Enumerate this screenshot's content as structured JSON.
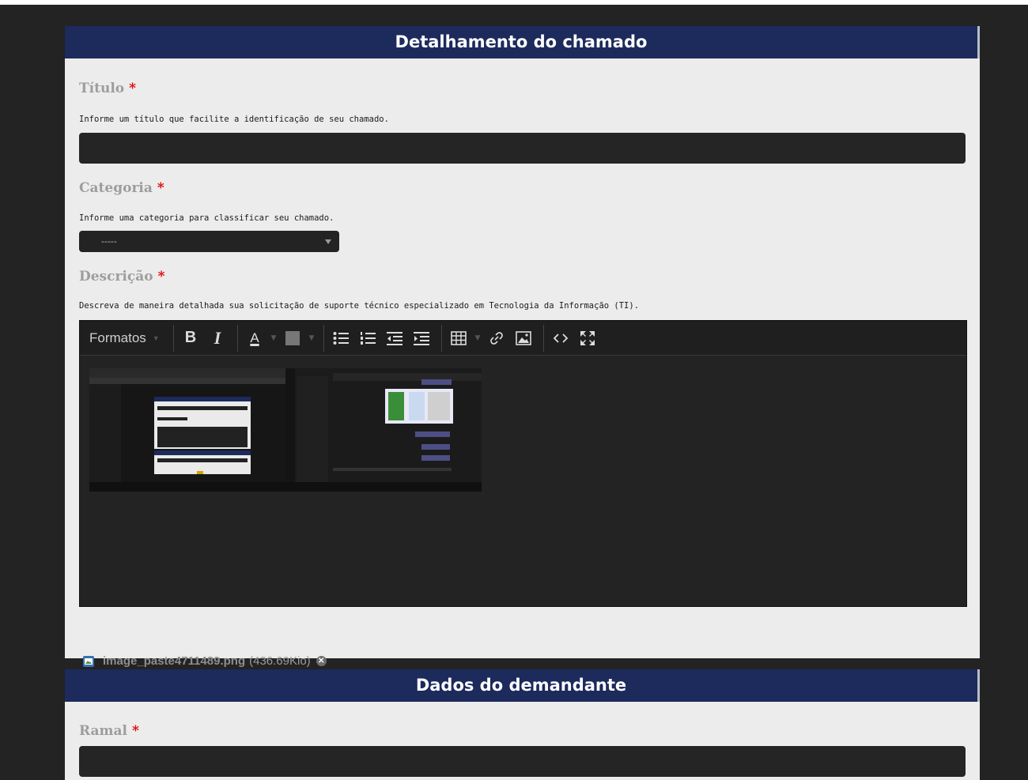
{
  "section1": {
    "title": "Detalhamento do chamado",
    "titulo": {
      "label": "Título",
      "required": "*",
      "hint": "Informe um título que facilite a identificação de seu chamado.",
      "value": ""
    },
    "categoria": {
      "label": "Categoria",
      "required": "*",
      "hint": "Informe uma categoria para classificar seu chamado.",
      "selected": "-----"
    },
    "descricao": {
      "label": "Descrição",
      "required": "*",
      "hint": "Descreva de maneira detalhada sua solicitação de suporte técnico especializado em Tecnologia da Informação (TI).",
      "toolbar": {
        "formats": "Formatos",
        "bold": "B",
        "italic": "I",
        "text_color": "A",
        "icons": [
          "bold-icon",
          "italic-icon",
          "text-color-icon",
          "background-color-icon",
          "bullet-list-icon",
          "numbered-list-icon",
          "outdent-icon",
          "indent-icon",
          "table-icon",
          "link-icon",
          "image-icon",
          "source-code-icon",
          "fullscreen-icon"
        ]
      }
    },
    "attachment": {
      "filename": "image_paste4711489.png",
      "size": "(436.69Kio)"
    }
  },
  "section2": {
    "title": "Dados do demandante",
    "ramal": {
      "label": "Ramal",
      "required": "*",
      "value": ""
    }
  },
  "colors": {
    "header_bg": "#1c2a5c",
    "panel_bg": "#ececec",
    "page_bg": "#232323",
    "required": "#e00000"
  }
}
